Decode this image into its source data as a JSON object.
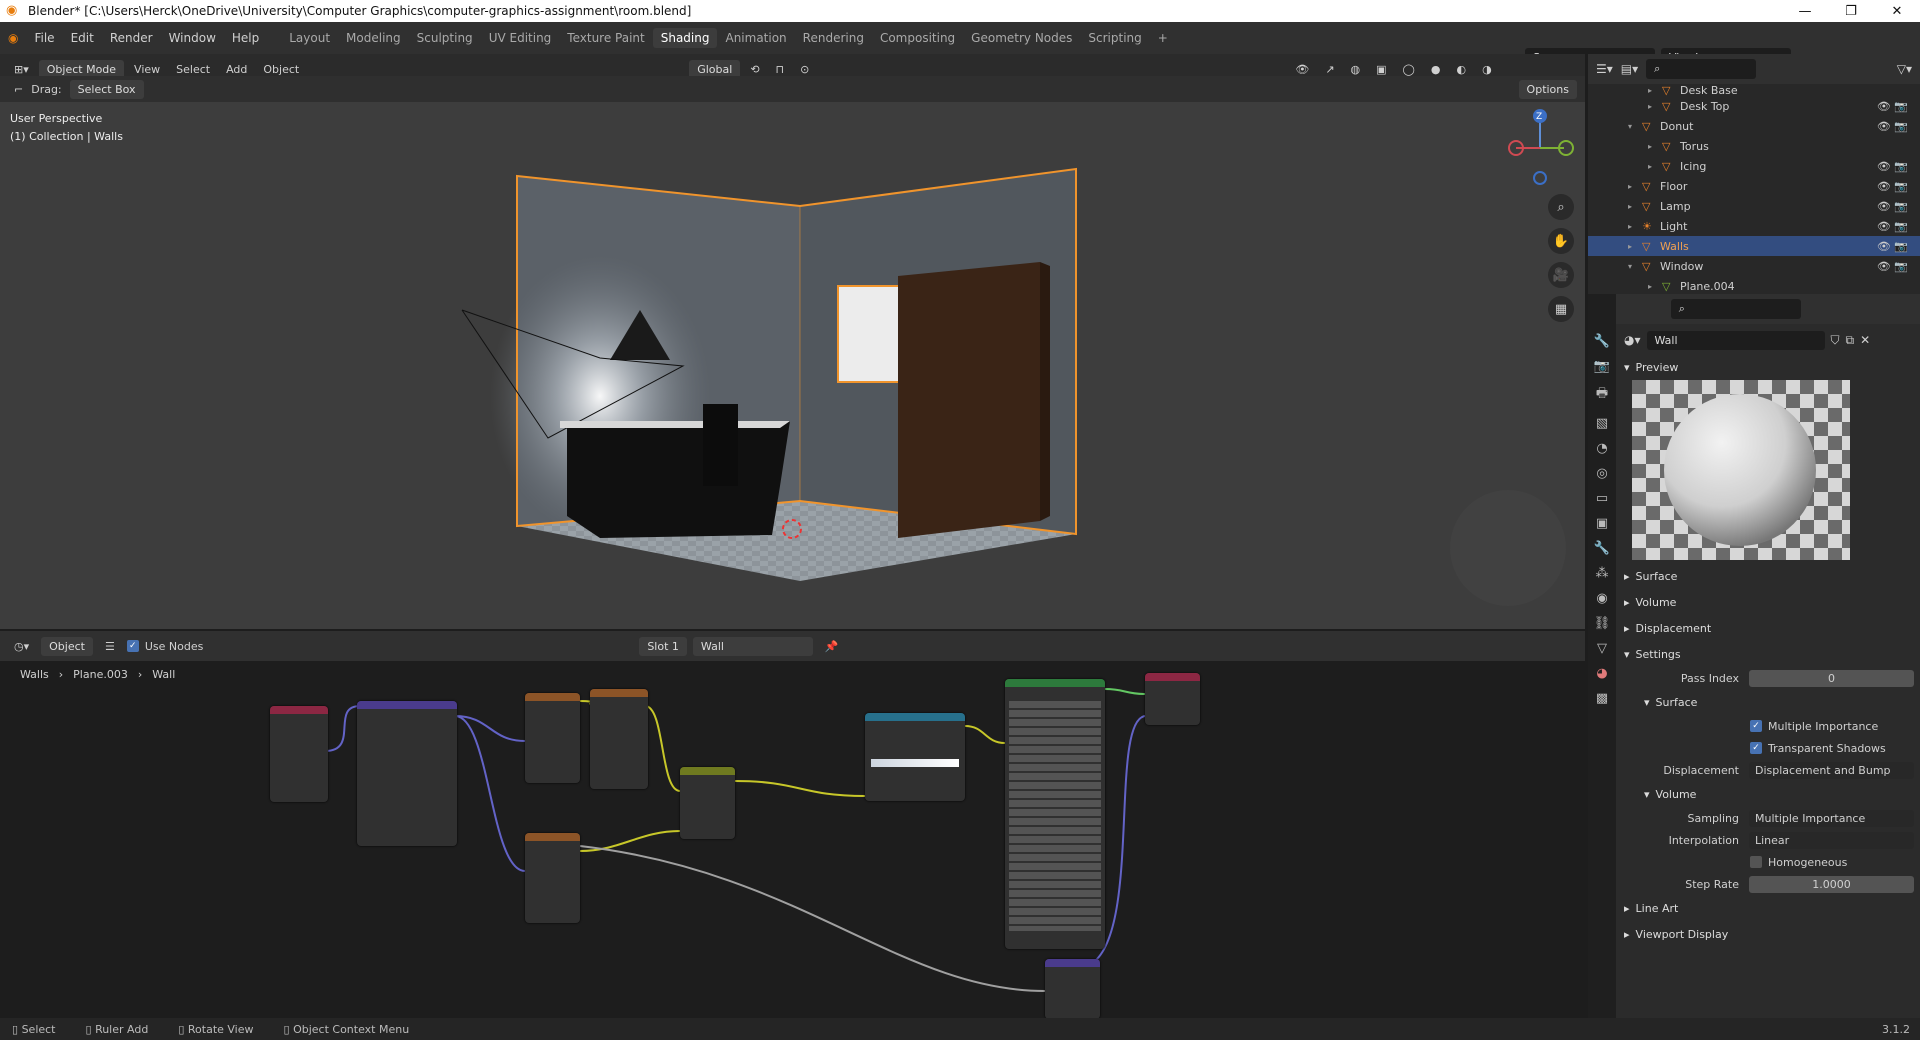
{
  "titlebar": {
    "title": "Blender* [C:\\Users\\Herck\\OneDrive\\University\\Computer Graphics\\computer-graphics-assignment\\room.blend]",
    "minimize": "—",
    "maximize": "❐",
    "close": "✕"
  },
  "menu": [
    "File",
    "Edit",
    "Render",
    "Window",
    "Help"
  ],
  "workspaces": [
    "Layout",
    "Modeling",
    "Sculpting",
    "UV Editing",
    "Texture Paint",
    "Shading",
    "Animation",
    "Rendering",
    "Compositing",
    "Geometry Nodes",
    "Scripting",
    "+"
  ],
  "active_workspace": "Shading",
  "scene": {
    "scene_name": "Scene",
    "view_layer": "ViewLayer"
  },
  "viewport_header": {
    "mode": "Object Mode",
    "menus": [
      "View",
      "Select",
      "Add",
      "Object"
    ],
    "transform": "Global",
    "options": "Options"
  },
  "viewport_tool": {
    "drag_label": "Drag:",
    "drag_value": "Select Box"
  },
  "viewport_info": {
    "perspective": "User Perspective",
    "collection": "(1) Collection | Walls"
  },
  "gizmo": {
    "z": "Z"
  },
  "node_header": {
    "object": "Object",
    "use_nodes": "Use Nodes",
    "slot": "Slot 1",
    "material": "Wall"
  },
  "breadcrumb": {
    "object": "Walls",
    "mesh": "Plane.003",
    "material": "Wall"
  },
  "outliner": {
    "items": [
      {
        "label": "Desk Base",
        "depth": 2,
        "expanded": false,
        "selected": false
      },
      {
        "label": "Desk Top",
        "depth": 2,
        "expanded": false,
        "selected": false
      },
      {
        "label": "Donut",
        "depth": 1,
        "expanded": true,
        "selected": false
      },
      {
        "label": "Torus",
        "depth": 2,
        "expanded": false,
        "selected": false
      },
      {
        "label": "Icing",
        "depth": 2,
        "expanded": false,
        "selected": false
      },
      {
        "label": "Floor",
        "depth": 1,
        "expanded": false,
        "selected": false
      },
      {
        "label": "Lamp",
        "depth": 1,
        "expanded": false,
        "selected": false
      },
      {
        "label": "Light",
        "depth": 1,
        "expanded": false,
        "selected": false
      },
      {
        "label": "Walls",
        "depth": 1,
        "expanded": false,
        "selected": true
      },
      {
        "label": "Window",
        "depth": 1,
        "expanded": true,
        "selected": false
      },
      {
        "label": "Plane.004",
        "depth": 2,
        "expanded": false,
        "selected": false
      }
    ]
  },
  "properties": {
    "material_name": "Wall",
    "preview": "Preview",
    "panels": [
      "Surface",
      "Volume",
      "Displacement",
      "Settings"
    ],
    "settings": {
      "pass_index_label": "Pass Index",
      "pass_index": "0",
      "surface_title": "Surface",
      "multiple_importance": "Multiple Importance",
      "transparent_shadows": "Transparent Shadows",
      "displacement_label": "Displacement",
      "displacement_value": "Displacement and Bump",
      "volume_title": "Volume",
      "sampling_label": "Sampling",
      "sampling_value": "Multiple Importance",
      "interpolation_label": "Interpolation",
      "interpolation_value": "Linear",
      "homogeneous": "Homogeneous",
      "step_rate_label": "Step Rate",
      "step_rate": "1.0000"
    },
    "bottom_panels": [
      "Line Art",
      "Viewport Display"
    ]
  },
  "statusbar": {
    "select": "Select",
    "ruler": "Ruler Add",
    "rotate": "Rotate View",
    "context": "Object Context Menu",
    "version": "3.1.2"
  },
  "colors": {
    "accent": "#4772b3",
    "selection_outline": "#f0942c",
    "header": "#303030"
  }
}
